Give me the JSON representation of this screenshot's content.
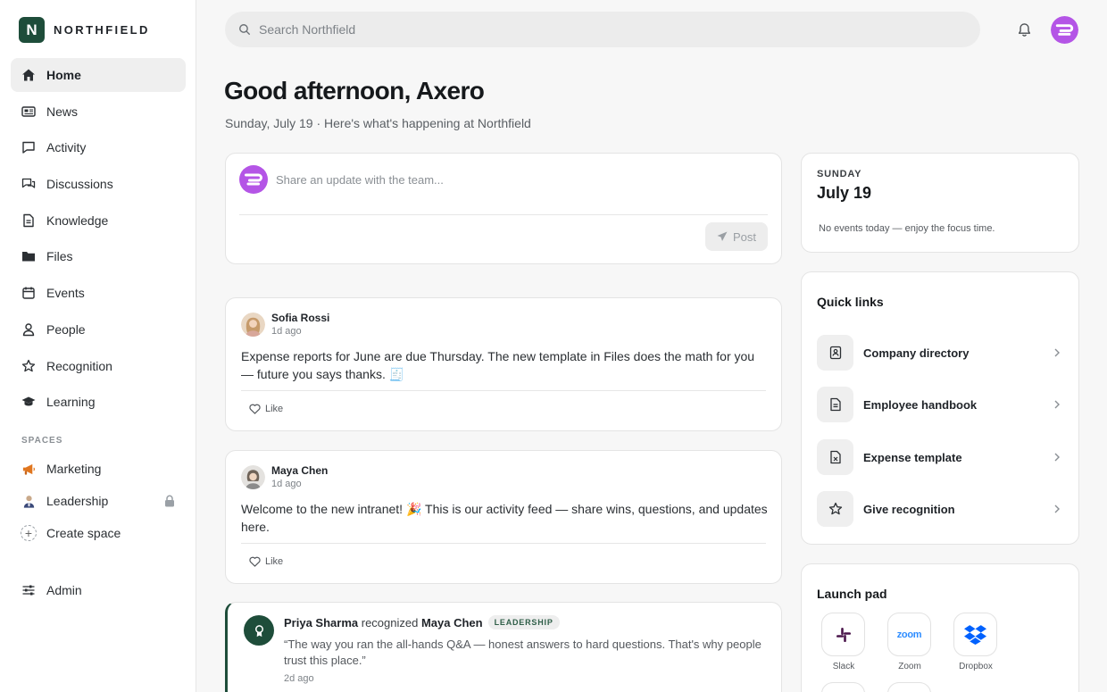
{
  "brand": {
    "mark": "N",
    "name": "NORTHFIELD"
  },
  "nav": {
    "items": [
      {
        "label": "Home"
      },
      {
        "label": "News"
      },
      {
        "label": "Activity"
      },
      {
        "label": "Discussions"
      },
      {
        "label": "Knowledge"
      },
      {
        "label": "Files"
      },
      {
        "label": "Events"
      },
      {
        "label": "People"
      },
      {
        "label": "Recognition"
      },
      {
        "label": "Learning"
      }
    ]
  },
  "spaces": {
    "title": "SPACES",
    "items": [
      {
        "label": "Marketing"
      },
      {
        "label": "Leadership"
      },
      {
        "label": "Create space"
      }
    ]
  },
  "admin": {
    "label": "Admin"
  },
  "search": {
    "placeholder": "Search Northfield"
  },
  "greeting": {
    "title": "Good afternoon, Axero",
    "subtitle": "Sunday, July 19 · Here's what's happening at Northfield"
  },
  "composer": {
    "placeholder": "Share an update with the team...",
    "post_label": "Post"
  },
  "feed": {
    "posts": [
      {
        "author": "Sofia Rossi",
        "time": "1d ago",
        "body": "Expense reports for June are due Thursday. The new template in Files does the math for you — future you says thanks. 🧾",
        "like_label": "Like"
      },
      {
        "author": "Maya Chen",
        "time": "1d ago",
        "body": "Welcome to the new intranet! 🎉 This is our activity feed — share wins, questions, and updates here.",
        "like_label": "Like"
      }
    ],
    "recognition": {
      "giver": "Priya Sharma",
      "verb": "recognized",
      "receiver": "Maya Chen",
      "tag": "LEADERSHIP",
      "quote": "“The way you ran the all-hands Q&A — honest answers to hard questions. That's why people trust this place.”",
      "time": "2d ago"
    }
  },
  "calendar": {
    "weekday": "SUNDAY",
    "date": "July 19",
    "note": "No events today — enjoy the focus time."
  },
  "quick_links": {
    "title": "Quick links",
    "items": [
      {
        "label": "Company directory"
      },
      {
        "label": "Employee handbook"
      },
      {
        "label": "Expense template"
      },
      {
        "label": "Give recognition"
      }
    ]
  },
  "launch_pad": {
    "title": "Launch pad",
    "apps": [
      {
        "name": "Slack"
      },
      {
        "name": "Zoom",
        "logo_text": "zoom"
      },
      {
        "name": "Dropbox"
      }
    ]
  },
  "colors": {
    "brand": "#1e4d3a",
    "avatar_accent": "#b455e6"
  }
}
